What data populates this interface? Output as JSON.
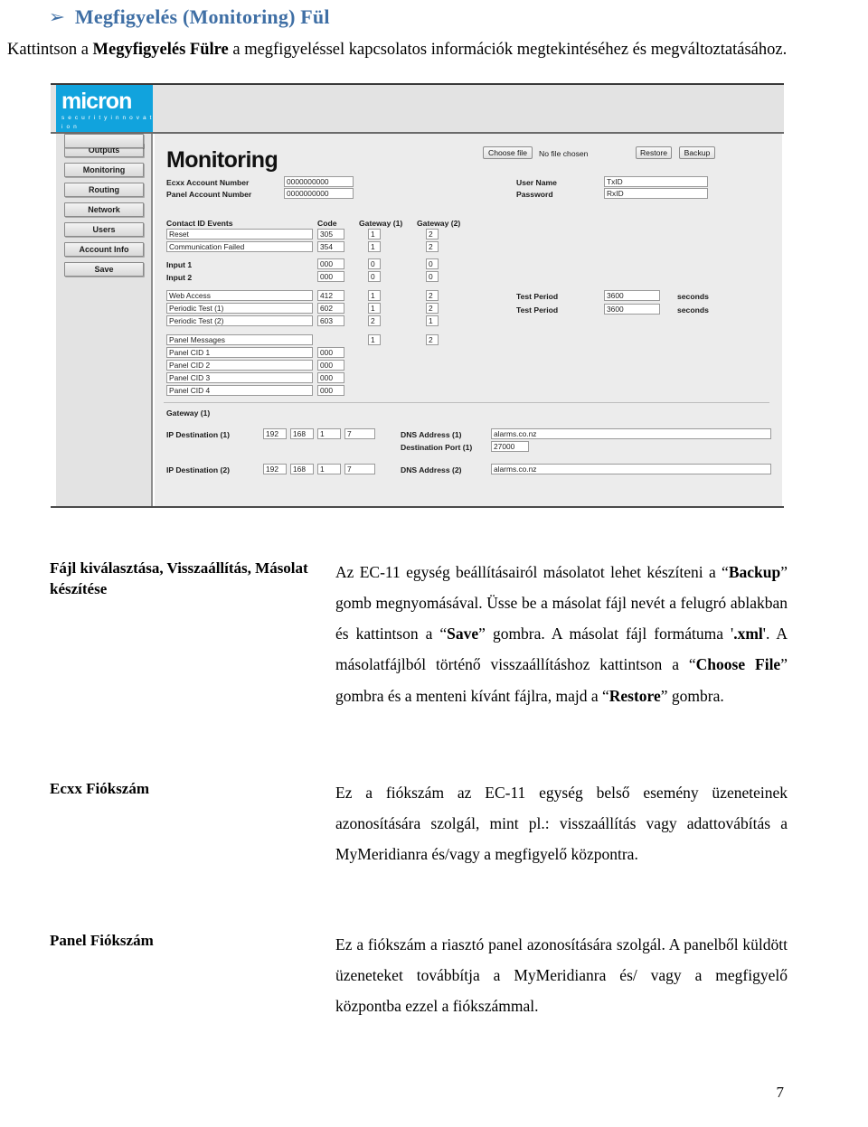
{
  "heading": {
    "bullet": "➢",
    "title": "Megfigyelés (Monitoring) Fül"
  },
  "intro": {
    "part1": "Kattintson a ",
    "bold": "Megyfigyelés Fülre",
    "part2": " a megfigyeléssel kapcsolatos információk megtekintéséhez és megváltoztatásához."
  },
  "screenshot": {
    "logo": {
      "word": "micron",
      "tagline": "s e c u r i t y  i n n o v a t i o n",
      "color": "#11a3dd"
    },
    "nav": [
      {
        "label": "Outputs"
      },
      {
        "label": "Monitoring"
      },
      {
        "label": "Routing"
      },
      {
        "label": "Network"
      },
      {
        "label": "Users"
      },
      {
        "label": "Account Info"
      },
      {
        "label": "Save"
      }
    ],
    "page_title": "Monitoring",
    "file_controls": {
      "choose_file": "Choose file",
      "no_file": "No file chosen",
      "restore": "Restore",
      "backup": "Backup"
    },
    "credentials": {
      "user_name_label": "User Name",
      "user_name_value": "TxID",
      "password_label": "Password",
      "password_value": "RxID"
    },
    "accounts": {
      "ecxx_label": "Ecxx Account Number",
      "ecxx_value": "0000000000",
      "panel_label": "Panel Account Number",
      "panel_value": "0000000000"
    },
    "table": {
      "headers": {
        "events": "Contact ID Events",
        "code": "Code",
        "gw1": "Gateway (1)",
        "gw2": "Gateway (2)"
      },
      "group1": [
        {
          "name": "Reset",
          "code": "305",
          "gw1": "1",
          "gw2": "2",
          "bold": false
        },
        {
          "name": "Communication Failed",
          "code": "354",
          "gw1": "1",
          "gw2": "2",
          "bold": false
        }
      ],
      "group2": [
        {
          "name": "Input 1",
          "code": "000",
          "gw1": "0",
          "gw2": "0",
          "bold": true
        },
        {
          "name": "Input 2",
          "code": "000",
          "gw1": "0",
          "gw2": "0",
          "bold": true
        }
      ],
      "group3": [
        {
          "name": "Web Access",
          "code": "412",
          "gw1": "1",
          "gw2": "2",
          "bold": false
        },
        {
          "name": "Periodic Test (1)",
          "code": "602",
          "gw1": "1",
          "gw2": "2",
          "bold": false
        },
        {
          "name": "Periodic Test (2)",
          "code": "603",
          "gw1": "2",
          "gw2": "1",
          "bold": false
        }
      ],
      "group4": [
        {
          "name": "Panel Messages",
          "code": "",
          "gw1": "1",
          "gw2": "2",
          "bold": false
        },
        {
          "name": "Panel CID 1",
          "code": "000",
          "gw1": "",
          "gw2": "",
          "bold": false
        },
        {
          "name": "Panel CID 2",
          "code": "000",
          "gw1": "",
          "gw2": "",
          "bold": false
        },
        {
          "name": "Panel CID 3",
          "code": "000",
          "gw1": "",
          "gw2": "",
          "bold": false
        },
        {
          "name": "Panel CID 4",
          "code": "000",
          "gw1": "",
          "gw2": "",
          "bold": false
        }
      ]
    },
    "test_periods": [
      {
        "label": "Test Period",
        "value": "3600",
        "unit": "seconds"
      },
      {
        "label": "Test Period",
        "value": "3600",
        "unit": "seconds"
      }
    ],
    "gateway": {
      "title": "Gateway (1)",
      "rows": [
        {
          "ip_label": "IP Destination (1)",
          "octets": [
            "192",
            "168",
            "1",
            "7"
          ],
          "dns_label": "DNS Address (1)",
          "dns_value": "alarms.co.nz",
          "port_label": "Destination Port (1)",
          "port_value": "27000"
        },
        {
          "ip_label": "IP Destination (2)",
          "octets": [
            "192",
            "168",
            "1",
            "7"
          ],
          "dns_label": "DNS Address (2)",
          "dns_value": "alarms.co.nz",
          "port_label": "",
          "port_value": ""
        }
      ]
    }
  },
  "sections": [
    {
      "term": "Fájl kiválasztása, Visszaállítás, Másolat készítése",
      "body_html": "Az EC-11 egység beállításairól másolatot lehet készíteni a “<b>Backup</b>” gomb megnyomásával. Üsse be a másolat fájl nevét a felugró ablakban és kattintson a “<b>Save</b>” gombra. A másolat fájl formátuma '<b>.xml</b>'. A másolatfájlból történő visszaállításhoz kattintson a “<b>Choose File</b>” gombra és a menteni kívánt fájlra, majd a “<b>Restore</b>” gombra."
    },
    {
      "term": "Ecxx Fiókszám",
      "body_html": "Ez a fiókszám az EC-11 egység belső esemény üzeneteinek azonosítására szolgál, mint pl.: visszaállítás vagy adattovábítás a MyMeridianra és/vagy a megfigyelő központra."
    },
    {
      "term": "Panel Fiókszám",
      "body_html": "Ez a fiókszám a riasztó panel azonosítására szolgál. A panelből küldött üzeneteket továbbítja a MyMeridianra és/ vagy a megfigyelő központba ezzel a fiókszámmal."
    }
  ],
  "page_number": "7"
}
